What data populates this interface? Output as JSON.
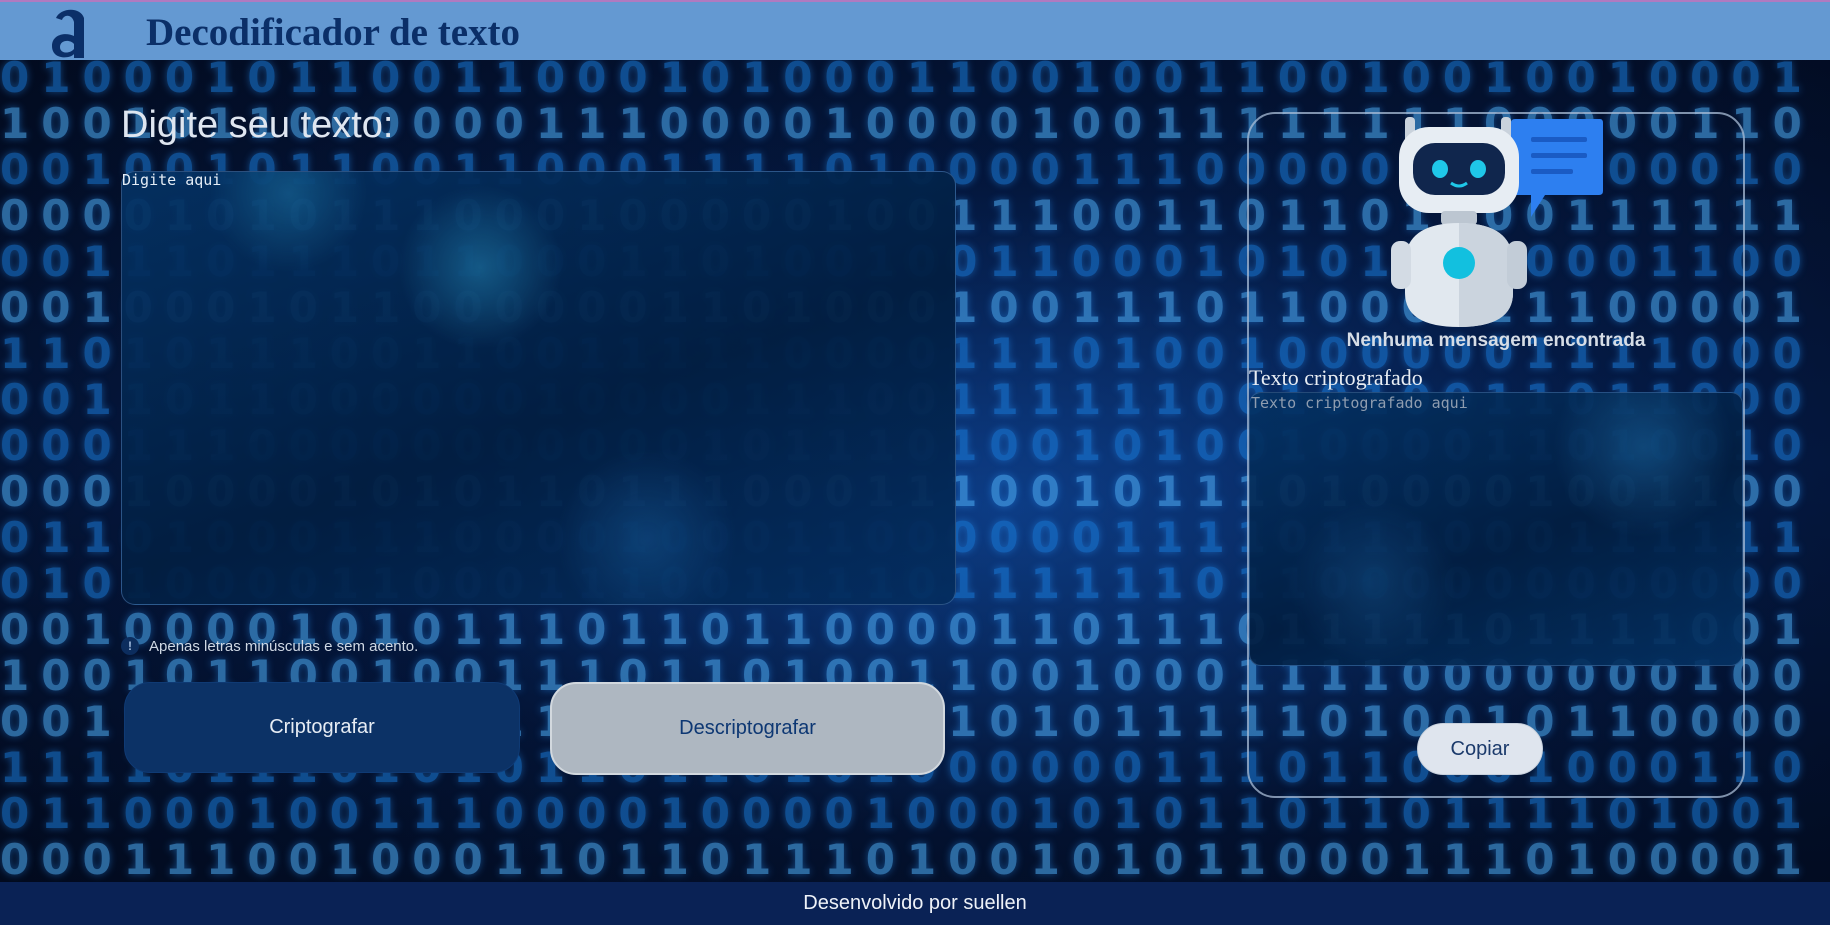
{
  "header": {
    "logo_icon": "alura-a-logo-icon",
    "title": "Decodificador de texto",
    "background_color": "#6499d2",
    "title_color": "#0b2f68"
  },
  "input_section": {
    "heading": "Digite seu texto:",
    "placeholder": "Digite aqui",
    "hint_icon": "exclamation-circle-icon",
    "hint": "Apenas letras minúsculas e sem acento.",
    "encrypt_button": "Criptografar",
    "decrypt_button": "Descriptografar"
  },
  "output_panel": {
    "illustration": "robot-with-chat-bubble-icon",
    "empty_message": "Nenhuma mensagem encontrada",
    "label": "Texto criptografado",
    "placeholder": "Texto criptografado aqui",
    "copy_button": "Copiar"
  },
  "footer": {
    "text": "Desenvolvido por suellen",
    "background_color": "#0a2255"
  },
  "colors": {
    "primary_button": "#0c3266",
    "secondary_button": "#aeb7c1",
    "copy_button": "#dfe5ee"
  }
}
